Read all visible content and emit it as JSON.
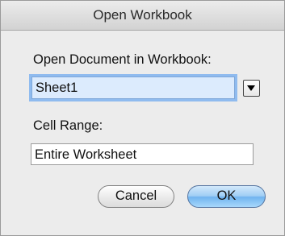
{
  "dialog": {
    "title": "Open Workbook",
    "open_document_label": "Open Document in Workbook:",
    "sheet_value": "Sheet1",
    "dropdown_icon": "triangle-down-icon",
    "cell_range_label": "Cell Range:",
    "cell_range_value": "Entire Worksheet",
    "cancel_label": "Cancel",
    "ok_label": "OK"
  },
  "colors": {
    "focus_ring": "#8fbbef",
    "default_button": "#6fb3ef"
  }
}
